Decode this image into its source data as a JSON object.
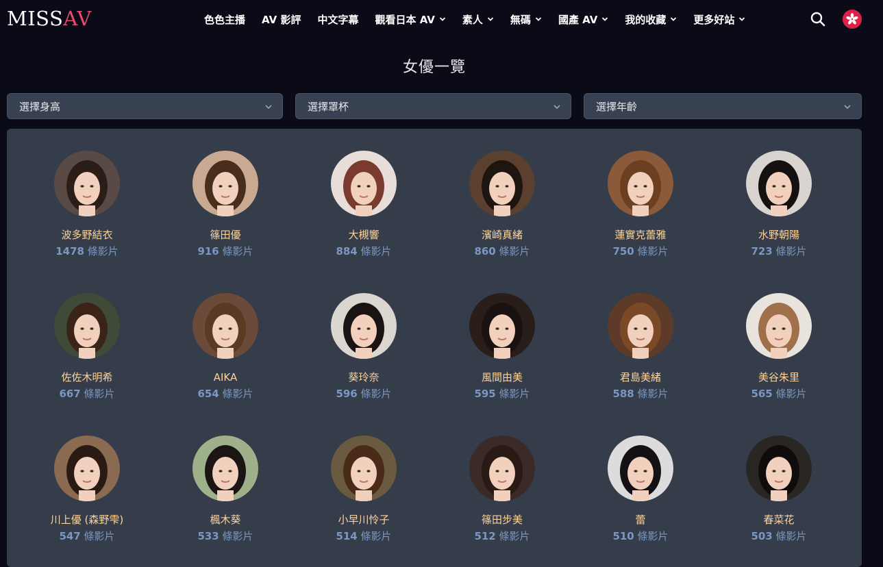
{
  "header": {
    "logo_part1": "MISS",
    "logo_part2": "AV",
    "nav": [
      {
        "label": "色色主播",
        "dropdown": false
      },
      {
        "label": "AV 影評",
        "dropdown": false
      },
      {
        "label": "中文字幕",
        "dropdown": false
      },
      {
        "label": "觀看日本 AV",
        "dropdown": true
      },
      {
        "label": "素人",
        "dropdown": true
      },
      {
        "label": "無碼",
        "dropdown": true
      },
      {
        "label": "國產 AV",
        "dropdown": true
      },
      {
        "label": "我的收藏",
        "dropdown": true
      },
      {
        "label": "更多好站",
        "dropdown": true
      }
    ],
    "search_icon": "search-icon",
    "language_icon": "hong-kong-flag-icon"
  },
  "page_title": "女優一覽",
  "filters": [
    {
      "label": "選擇身高"
    },
    {
      "label": "選擇罩杯"
    },
    {
      "label": "選擇年齡"
    }
  ],
  "count_suffix": "條影片",
  "actresses": [
    {
      "name": "波多野結衣",
      "count": "1478"
    },
    {
      "name": "篠田優",
      "count": "916"
    },
    {
      "name": "大槻響",
      "count": "884"
    },
    {
      "name": "濱崎真緒",
      "count": "860"
    },
    {
      "name": "蓮實克蕾雅",
      "count": "750"
    },
    {
      "name": "水野朝陽",
      "count": "723"
    },
    {
      "name": "佐佐木明希",
      "count": "667"
    },
    {
      "name": "AIKA",
      "count": "654"
    },
    {
      "name": "葵玲奈",
      "count": "596"
    },
    {
      "name": "風間由美",
      "count": "595"
    },
    {
      "name": "君島美緒",
      "count": "588"
    },
    {
      "name": "美谷朱里",
      "count": "565"
    },
    {
      "name": "川上優 (森野雫)",
      "count": "547"
    },
    {
      "name": "楓木葵",
      "count": "533"
    },
    {
      "name": "小早川怜子",
      "count": "514"
    },
    {
      "name": "篠田步美",
      "count": "512"
    },
    {
      "name": "蕾",
      "count": "510"
    },
    {
      "name": "春菜花",
      "count": "503"
    }
  ],
  "avatar_colors": [
    {
      "bg": "#5a4a45",
      "hair": "#2b1d17"
    },
    {
      "bg": "#c9a992",
      "hair": "#4a2e1c"
    },
    {
      "bg": "#e8ddd8",
      "hair": "#7a3b2e"
    },
    {
      "bg": "#5b4030",
      "hair": "#1e1410"
    },
    {
      "bg": "#8a5a3a",
      "hair": "#6b3f1f"
    },
    {
      "bg": "#d9d4cf",
      "hair": "#151111"
    },
    {
      "bg": "#3f4a38",
      "hair": "#3a2418"
    },
    {
      "bg": "#6b4a3a",
      "hair": "#5a3a22"
    },
    {
      "bg": "#dcd6d0",
      "hair": "#1a1313"
    },
    {
      "bg": "#2a1e1a",
      "hair": "#1a1210"
    },
    {
      "bg": "#5e3b28",
      "hair": "#7a4a28"
    },
    {
      "bg": "#e9e3de",
      "hair": "#a0704a"
    },
    {
      "bg": "#8a6a50",
      "hair": "#2a1a14"
    },
    {
      "bg": "#9fb18a",
      "hair": "#1b1614"
    },
    {
      "bg": "#6a5a40",
      "hair": "#4a2a18"
    },
    {
      "bg": "#3a2a28",
      "hair": "#2a1a16"
    },
    {
      "bg": "#dcdcdc",
      "hair": "#141014"
    },
    {
      "bg": "#2a2624",
      "hair": "#100c0c"
    }
  ],
  "skin_color": "#f1d1bd"
}
